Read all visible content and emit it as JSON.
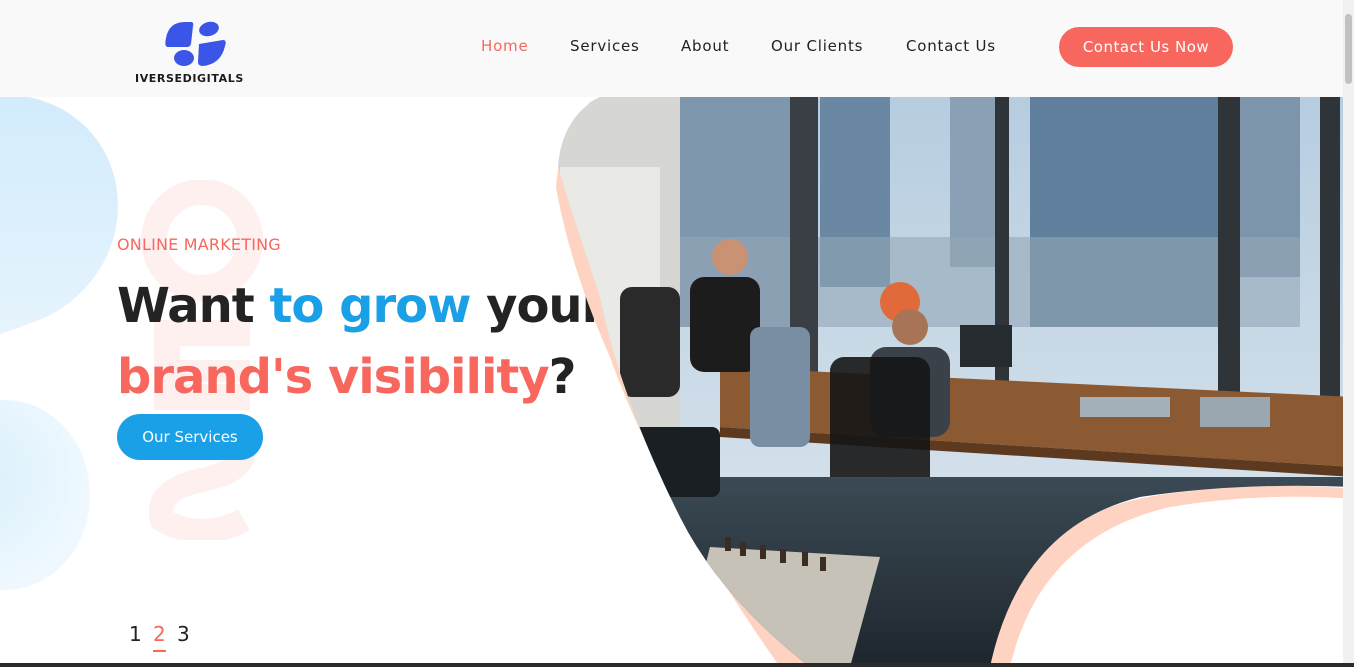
{
  "brand": {
    "name": "IVERSEDIGITALS",
    "logo_icon": "blue-cross-blob-logo",
    "colors": {
      "accent": "#f7675e",
      "blue": "#1aa0e6",
      "dark": "#232323",
      "logo_blue": "#3b55e6"
    }
  },
  "nav": {
    "items": [
      {
        "label": "Home",
        "active": true
      },
      {
        "label": "Services",
        "active": false
      },
      {
        "label": "About",
        "active": false
      },
      {
        "label": "Our Clients",
        "active": false
      },
      {
        "label": "Contact Us",
        "active": false
      }
    ],
    "cta_label": "Contact Us Now"
  },
  "hero": {
    "eyebrow": "ONLINE MARKETING",
    "headline_line1": {
      "part1": "Want ",
      "part2": "to grow",
      "part3": " your"
    },
    "headline_line2": {
      "part1": "brand's visibility",
      "part2": "?"
    },
    "button_label": "Our Services",
    "photo": "office-people-working-at-desks-city-view"
  },
  "pager": {
    "pages": [
      "1",
      "2",
      "3"
    ],
    "current": "2"
  }
}
